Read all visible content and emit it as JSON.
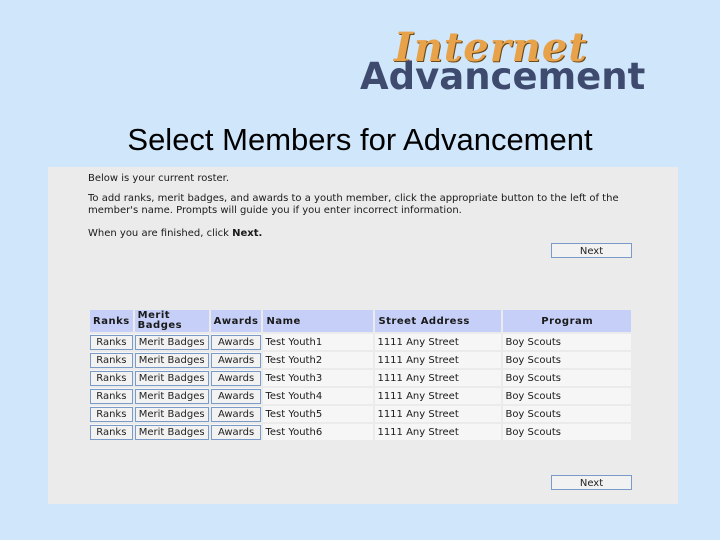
{
  "logo": {
    "top_word": "Internet",
    "bottom_word": "Advancement"
  },
  "page_title": "Select Members for Advancement",
  "intro": {
    "line1": "Below is your current roster.",
    "line2": "To add ranks, merit badges, and awards to a youth member, click the appropriate button to the left of the member's name.  Prompts will guide you if you enter incorrect information.",
    "line3_prefix": "When you are finished, click ",
    "line3_bold": "Next."
  },
  "next_label": "Next",
  "table": {
    "headers": {
      "ranks": "Ranks",
      "merit_badges": "Merit Badges",
      "awards": "Awards",
      "name": "Name",
      "street": "Street Address",
      "program": "Program"
    },
    "rows": [
      {
        "ranks": "Ranks",
        "merit": "Merit Badges",
        "awards": "Awards",
        "name": "Test Youth1",
        "street": "1111 Any Street",
        "program": "Boy Scouts"
      },
      {
        "ranks": "Ranks",
        "merit": "Merit Badges",
        "awards": "Awards",
        "name": "Test Youth2",
        "street": "1111 Any Street",
        "program": "Boy Scouts"
      },
      {
        "ranks": "Ranks",
        "merit": "Merit Badges",
        "awards": "Awards",
        "name": "Test Youth3",
        "street": "1111 Any Street",
        "program": "Boy Scouts"
      },
      {
        "ranks": "Ranks",
        "merit": "Merit Badges",
        "awards": "Awards",
        "name": "Test Youth4",
        "street": "1111 Any Street",
        "program": "Boy Scouts"
      },
      {
        "ranks": "Ranks",
        "merit": "Merit Badges",
        "awards": "Awards",
        "name": "Test Youth5",
        "street": "1111 Any Street",
        "program": "Boy Scouts"
      },
      {
        "ranks": "Ranks",
        "merit": "Merit Badges",
        "awards": "Awards",
        "name": "Test Youth6",
        "street": "1111 Any Street",
        "program": "Boy Scouts"
      }
    ]
  },
  "colors": {
    "background": "#cfe6fb",
    "panel": "#ebebeb",
    "header_row": "#c6cff7",
    "button_border": "#7a9ac8"
  }
}
